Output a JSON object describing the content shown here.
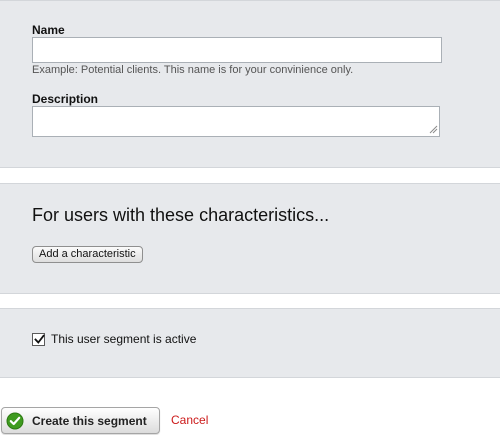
{
  "details": {
    "name_label": "Name",
    "name_value": "",
    "name_hint": "Example: Potential clients. This name is for your convinience only.",
    "description_label": "Description",
    "description_value": ""
  },
  "characteristics": {
    "heading": "For users with these characteristics...",
    "add_button_label": "Add a characteristic"
  },
  "status": {
    "active_label": "This user segment is active",
    "active_checked": true
  },
  "actions": {
    "submit_label": "Create this segment",
    "cancel_label": "Cancel"
  },
  "colors": {
    "panel_background": "#e7e9ec",
    "cancel_link": "#cc1a1a",
    "success_icon": "#3f9b1f"
  },
  "icons": {
    "submit": "checkmark-circle-icon",
    "checkbox": "checkmark-icon"
  }
}
